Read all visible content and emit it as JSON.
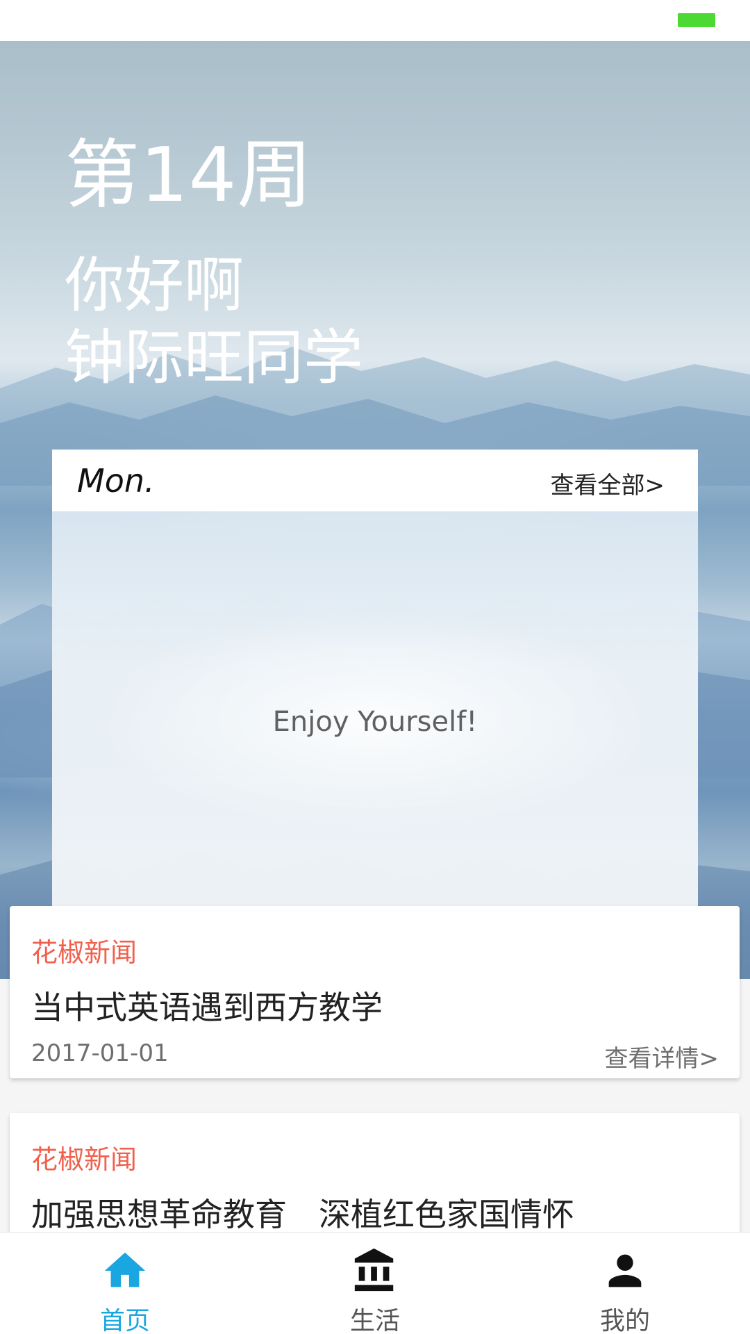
{
  "status_bar": {
    "battery_color": "#4cd934"
  },
  "header": {
    "week": "第14周",
    "greeting_line1": "你好啊",
    "greeting_line2": "钟际旺同学"
  },
  "schedule": {
    "day": "Mon.",
    "view_all": "查看全部>",
    "empty_message": "Enjoy Yourself!"
  },
  "news": [
    {
      "tag": "花椒新闻",
      "title": "当中式英语遇到西方教学",
      "date": "2017-01-01",
      "detail": "查看详情>"
    },
    {
      "tag": "花椒新闻",
      "title": "加强思想革命教育　深植红色家国情怀",
      "date": "",
      "detail": ""
    }
  ],
  "bottom_nav": {
    "items": [
      {
        "label": "首页",
        "icon": "home-icon",
        "active": true
      },
      {
        "label": "生活",
        "icon": "bank-icon",
        "active": false
      },
      {
        "label": "我的",
        "icon": "person-icon",
        "active": false
      }
    ],
    "active_color": "#1aa6e0",
    "inactive_color": "#555555"
  },
  "colors": {
    "news_tag": "#f0604d",
    "accent": "#1aa6e0"
  }
}
